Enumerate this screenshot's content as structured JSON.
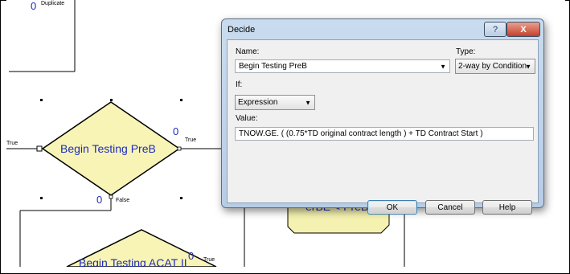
{
  "canvas": {
    "top_label": "Duplicate",
    "top_count": "0",
    "decide1": {
      "name": "Begin Testing PreB",
      "count_true": "0",
      "count_false": "0",
      "true_label": "True",
      "false_label": "False"
    },
    "incoming_true_label": "True",
    "decide2": {
      "name": "Begin Testing ACAT II",
      "count_true": "0",
      "true_label": "True"
    },
    "hidden_block_text": "erBE < PreB"
  },
  "dialog": {
    "title": "Decide",
    "name_label": "Name:",
    "name_value": "Begin Testing PreB",
    "type_label": "Type:",
    "type_value": "2-way by Condition",
    "if_label": "If:",
    "if_value": "Expression",
    "value_label": "Value:",
    "value_text": "TNOW.GE. ( (0.75*TD original contract length ) + TD Contract Start )",
    "ok_label": "OK",
    "cancel_label": "Cancel",
    "help_label": "Help",
    "help_glyph": "?",
    "close_glyph": "X"
  }
}
